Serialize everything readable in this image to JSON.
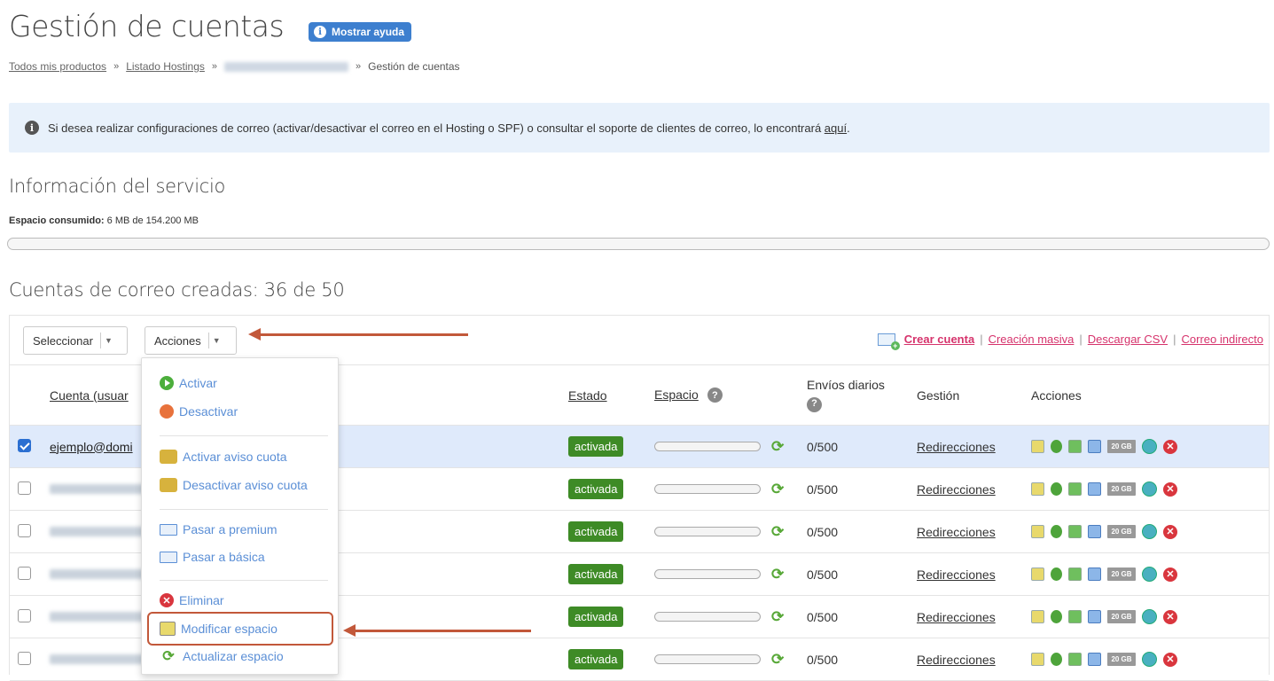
{
  "header": {
    "title": "Gestión de cuentas",
    "help_label": "Mostrar ayuda",
    "help_icon": "info-icon"
  },
  "breadcrumb": {
    "items": [
      "Todos mis productos",
      "Listado Hostings",
      "Gestión de cuentas"
    ],
    "separator": "»"
  },
  "notice": {
    "text": "Si desea realizar configuraciones de correo (activar/desactivar el correo en el Hosting o SPF) o consultar el soporte de clientes de correo, lo encontrará",
    "link": "aquí",
    "end": "."
  },
  "service": {
    "title": "Información del servicio",
    "space_label": "Espacio consumido:",
    "space_value": "6 MB de 154.200 MB",
    "usage_fraction": 4e-05
  },
  "accounts": {
    "title": "Cuentas de correo creadas: 36 de 50",
    "toolbar": {
      "select_label": "Seleccionar",
      "actions_label": "Acciones",
      "create_label": "Crear cuenta",
      "bulk_label": "Creación masiva",
      "csv_label": "Descargar CSV",
      "indirect_label": "Correo indirecto",
      "sep": "|"
    },
    "columns": {
      "account": "Cuenta (usuar",
      "status": "Estado",
      "space": "Espacio",
      "sends": "Envíos diarios",
      "management": "Gestión",
      "actions": "Acciones"
    },
    "rows": [
      {
        "name": "ejemplo@domi",
        "status": "activada",
        "sends": "0/500",
        "management": "Redirecciones",
        "size": "20 GB",
        "selected": true
      },
      {
        "name": "",
        "status": "activada",
        "sends": "0/500",
        "management": "Redirecciones",
        "size": "20 GB",
        "selected": false
      },
      {
        "name": "",
        "status": "activada",
        "sends": "0/500",
        "management": "Redirecciones",
        "size": "20 GB",
        "selected": false
      },
      {
        "name": "",
        "status": "activada",
        "sends": "0/500",
        "management": "Redirecciones",
        "size": "20 GB",
        "selected": false
      },
      {
        "name": "",
        "status": "activada",
        "sends": "0/500",
        "management": "Redirecciones",
        "size": "20 GB",
        "selected": false
      },
      {
        "name": "",
        "status": "activada",
        "sends": "0/500",
        "management": "Redirecciones",
        "size": "20 GB",
        "selected": false
      }
    ]
  },
  "actions_menu": {
    "items": [
      {
        "label": "Activar",
        "icon": "play-icon"
      },
      {
        "label": "Desactivar",
        "icon": "stop-icon"
      },
      {
        "label": "Activar aviso cuota",
        "icon": "wand-icon"
      },
      {
        "label": "Desactivar aviso cuota",
        "icon": "wand-icon"
      },
      {
        "label": "Pasar a premium",
        "icon": "mail-premium-icon"
      },
      {
        "label": "Pasar a básica",
        "icon": "mail-basic-icon"
      },
      {
        "label": "Eliminar",
        "icon": "delete-icon"
      },
      {
        "label": "Modificar espacio",
        "icon": "edit-icon"
      },
      {
        "label": "Actualizar espacio",
        "icon": "refresh-icon"
      }
    ],
    "highlighted_index": 7
  },
  "colors": {
    "accent": "#3d7fcf",
    "link": "#d6336c",
    "status_green": "#3e8b26",
    "annotation": "#c2583a",
    "selected_row": "#dfeafb"
  }
}
